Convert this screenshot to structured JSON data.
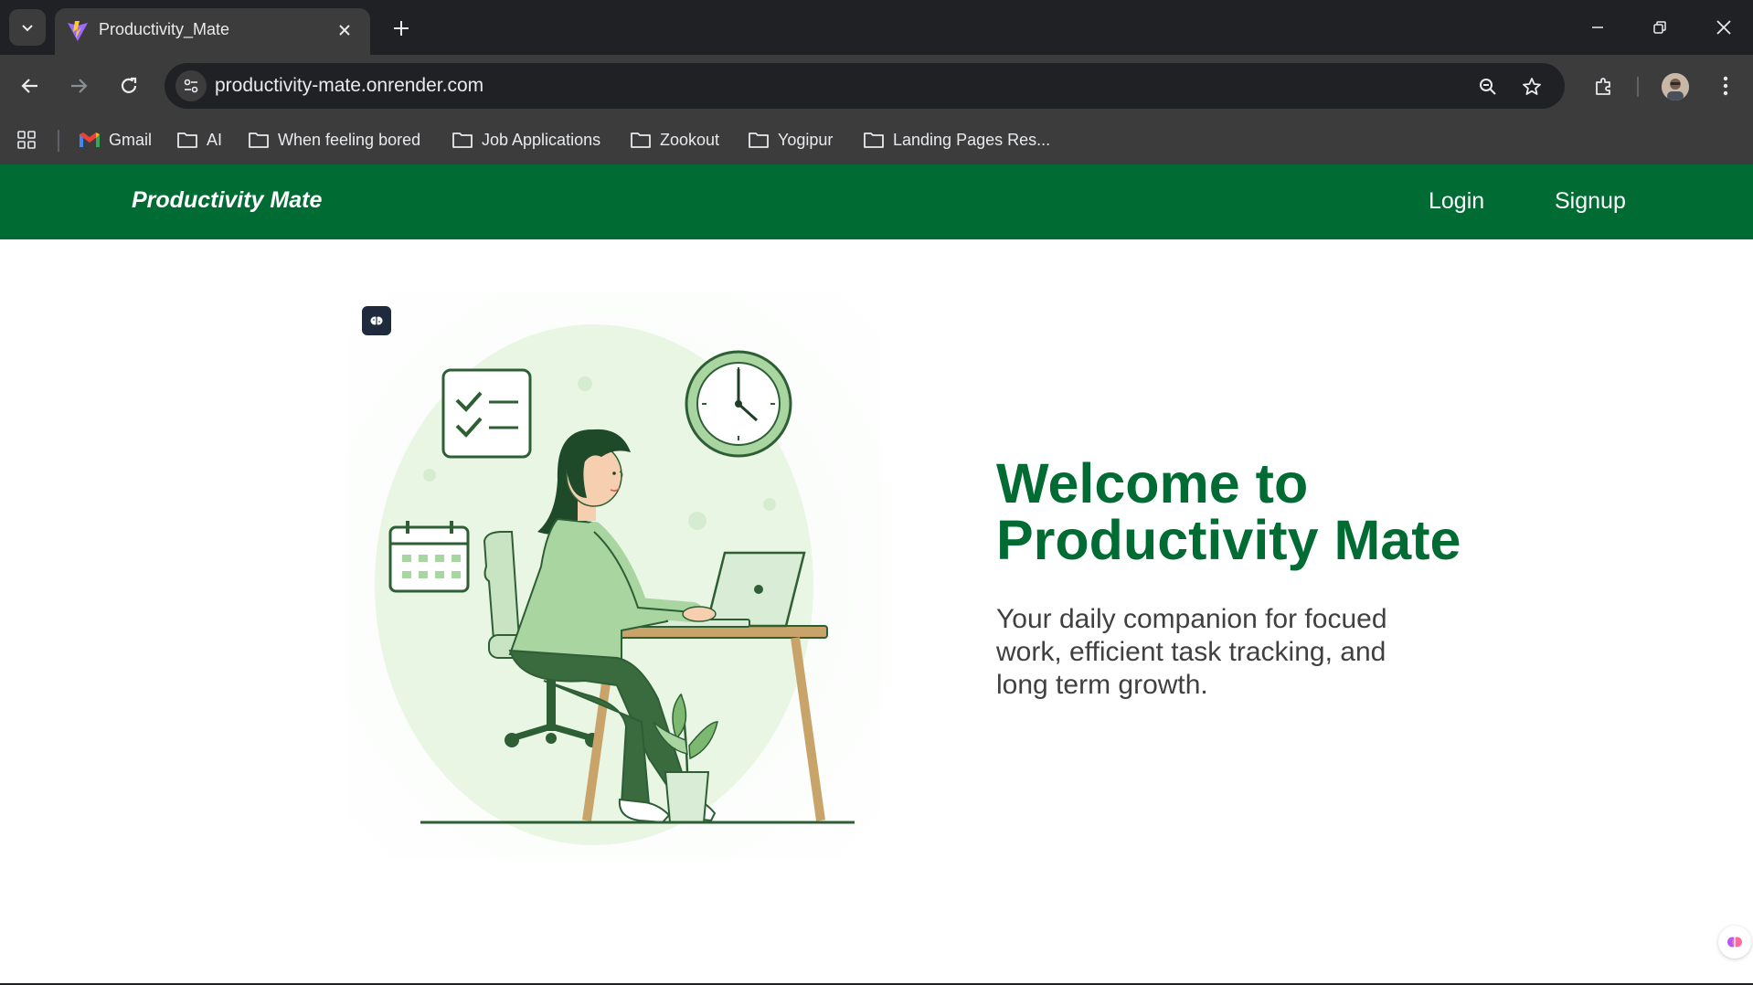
{
  "browser": {
    "tab": {
      "title": "Productivity_Mate"
    },
    "url": "productivity-mate.onrender.com",
    "bookmarks": [
      {
        "label": "Gmail",
        "icon": "gmail-icon"
      },
      {
        "label": "AI",
        "icon": "folder-icon"
      },
      {
        "label": "When feeling bored",
        "icon": "folder-icon"
      },
      {
        "label": "Job Applications",
        "icon": "folder-icon"
      },
      {
        "label": "Zookout",
        "icon": "folder-icon"
      },
      {
        "label": "Yogipur",
        "icon": "folder-icon"
      },
      {
        "label": "Landing Pages Res...",
        "icon": "folder-icon"
      }
    ]
  },
  "site": {
    "brand": "Productivity Mate",
    "nav": {
      "login": "Login",
      "signup": "Signup"
    },
    "hero": {
      "title": "Welcome to Productivity Mate",
      "subtitle": "Your daily companion for focued work, efficient task tracking, and long term growth."
    }
  },
  "colors": {
    "brand_green": "#006b33",
    "chrome_dark": "#202124",
    "chrome_mid": "#3c3c3c",
    "illustration_light_green": "#a8d5a0",
    "illustration_dark_green": "#3a6b3e",
    "desk_wood": "#c8a46a"
  }
}
